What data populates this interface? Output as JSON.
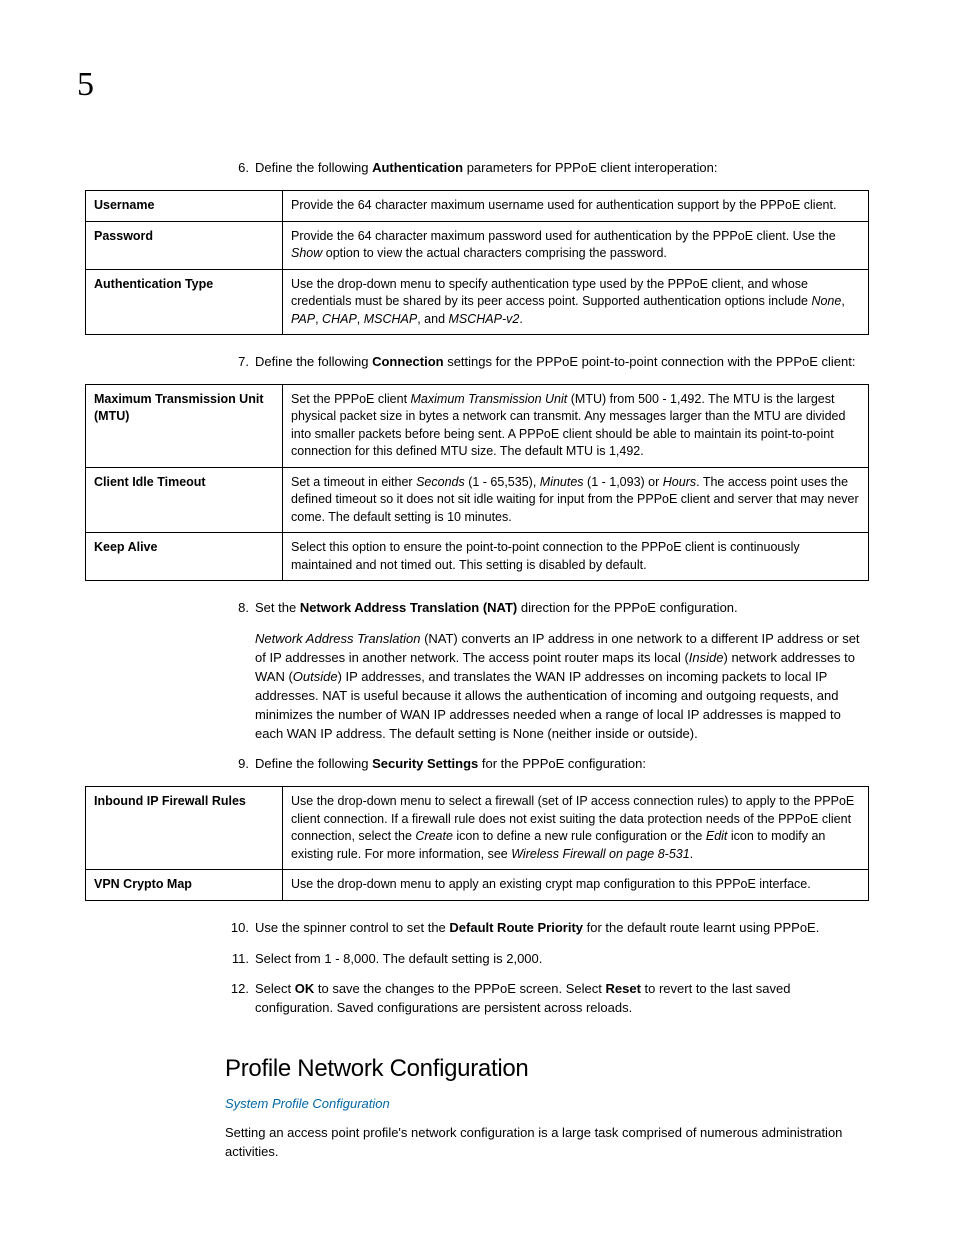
{
  "chapterNumber": "5",
  "steps": {
    "s6": {
      "num": "6.",
      "pre": "Define the following ",
      "bold": "Authentication",
      "post": " parameters for PPPoE client interoperation:"
    },
    "s7": {
      "num": "7.",
      "pre": "Define the following ",
      "bold": "Connection",
      "post": " settings for the PPPoE point-to-point connection with the PPPoE client:"
    },
    "s8": {
      "num": "8.",
      "pre": "Set the ",
      "bold": "Network Address Translation (NAT)",
      "post": " direction for the PPPoE configuration."
    },
    "s9": {
      "num": "9.",
      "pre": "Define the following ",
      "bold": "Security Settings",
      "post": " for the PPPoE configuration:"
    },
    "s10": {
      "num": "10.",
      "pre": "Use the spinner control to set the ",
      "bold": "Default Route Priority",
      "post": " for the default route learnt using PPPoE."
    },
    "s11": {
      "num": "11.",
      "text": "Select from 1 - 8,000. The default setting is 2,000."
    },
    "s12": {
      "num": "12.",
      "p1": "Select ",
      "b1": "OK",
      "p2": " to save the changes to the PPPoE screen. Select ",
      "b2": "Reset",
      "p3": " to revert to the last saved configuration. Saved configurations are persistent across reloads."
    }
  },
  "natPara": {
    "i1": "Network Address Translation",
    "t1": " (NAT) converts an IP address in one network to a different IP address or set of IP addresses in another network. The access point router maps its local (",
    "i2": "Inside",
    "t2": ") network addresses to WAN (",
    "i3": "Outside",
    "t3": ") IP addresses, and translates the WAN IP addresses on incoming packets to local IP addresses. NAT is useful because it allows the authentication of incoming and outgoing requests, and minimizes the number of WAN IP addresses needed when a range of local IP addresses is mapped to each WAN IP address. The default setting is None (neither inside or outside)."
  },
  "table1": {
    "r1": {
      "label": "Username",
      "desc": "Provide the 64 character maximum username used for authentication support by the PPPoE client."
    },
    "r2": {
      "label": "Password",
      "t1": "Provide the 64 character maximum password used for authentication by the PPPoE client. Use the ",
      "i1": "Show",
      "t2": " option to view the actual characters comprising the password."
    },
    "r3": {
      "label": "Authentication Type",
      "t1": "Use the drop-down menu to specify authentication type used by the PPPoE client, and whose credentials must be shared by its peer access point. Supported authentication options include ",
      "i1": "None",
      "c1": ", ",
      "i2": "PAP",
      "c2": ", ",
      "i3": "CHAP",
      "c3": ", ",
      "i4": "MSCHAP",
      "c4": ", and ",
      "i5": "MSCHAP-v2",
      "c5": "."
    }
  },
  "table2": {
    "r1": {
      "label": "Maximum Transmission Unit (MTU)",
      "t1": "Set the PPPoE client ",
      "i1": "Maximum Transmission Unit",
      "t2": " (MTU) from 500 - 1,492. The MTU is the largest physical packet size in bytes a network can transmit. Any messages larger than the MTU are divided into smaller packets before being sent. A PPPoE client should be able to maintain its point-to-point connection for this defined MTU size. The default MTU is 1,492."
    },
    "r2": {
      "label": "Client Idle Timeout",
      "t1": "Set a timeout in either ",
      "i1": "Seconds",
      "c1": " (1 - 65,535), ",
      "i2": "Minutes",
      "c2": " (1 - 1,093) or ",
      "i3": "Hours",
      "t2": ". The access point uses the defined timeout so it does not sit idle waiting for input from the PPPoE client and server that may never come. The default setting is 10 minutes."
    },
    "r3": {
      "label": "Keep Alive",
      "desc": "Select this option to ensure the point-to-point connection to the PPPoE client is continuously maintained and not timed out. This setting is disabled by default."
    }
  },
  "table3": {
    "r1": {
      "label": "Inbound IP Firewall Rules",
      "t1": "Use the drop-down menu to select a firewall (set of IP access connection rules) to apply to the PPPoE client connection. If a firewall rule does not exist suiting the data protection needs of the PPPoE client connection, select the ",
      "i1": "Create",
      "t2": " icon to define a new rule configuration or the ",
      "i2": "Edit",
      "t3": " icon to modify an existing rule. For more information, see ",
      "i3": "Wireless Firewall on page 8-531",
      "t4": "."
    },
    "r2": {
      "label": "VPN Crypto Map",
      "desc": "Use the drop-down menu to apply an existing crypt map configuration to this PPPoE interface."
    }
  },
  "sectionHeading": "Profile Network Configuration",
  "breadcrumbLink": "System Profile Configuration",
  "sectionIntro": "Setting an access point profile's network configuration is a large task comprised of numerous administration activities."
}
